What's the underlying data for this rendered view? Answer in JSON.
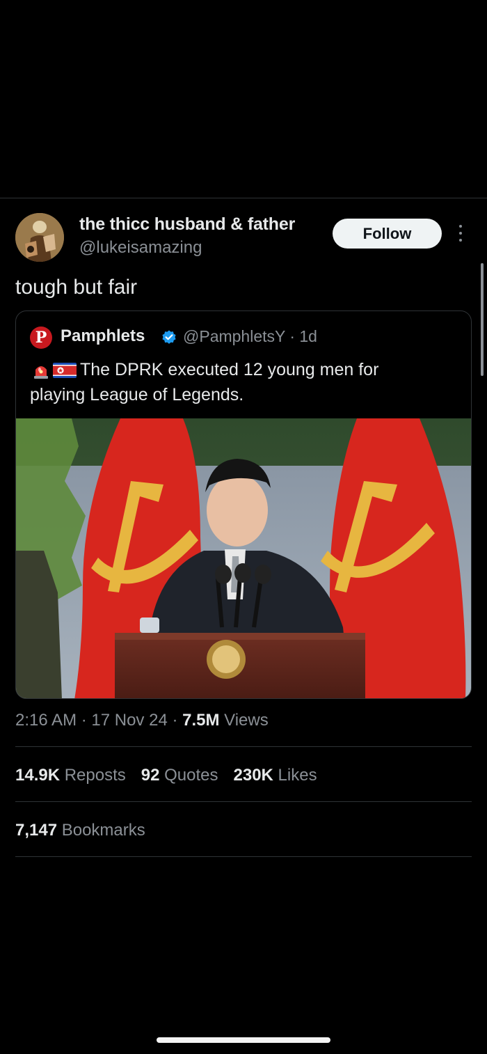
{
  "tweet": {
    "author_name": "the thicc husband & father",
    "author_handle": "@lukeisamazing",
    "follow_label": "Follow",
    "text": "tough but fair"
  },
  "quoted": {
    "logo_letter": "P",
    "name": "Pamphlets",
    "handle_time": "@PamphletsY · 1d",
    "text_line1": "The DPRK executed 12 young men for",
    "text_line2": "playing League of Legends."
  },
  "meta": {
    "time_date": "2:16 AM · 17 Nov 24 · ",
    "views_count": "7.5M",
    "views_label": " Views"
  },
  "stats": {
    "reposts_count": "14.9K",
    "reposts_label": " Reposts",
    "quotes_count": "92",
    "quotes_label": " Quotes",
    "likes_count": "230K",
    "likes_label": " Likes",
    "bookmarks_count": "7,147",
    "bookmarks_label": " Bookmarks"
  },
  "colors": {
    "background": "#000000",
    "follow_button": "#eff3f4",
    "verified": "#1d9bf0",
    "pamphlets_logo": "#c8191f"
  },
  "icons": {
    "more": "more-vertical-icon",
    "verified": "verified-badge-icon",
    "siren": "siren-emoji-icon",
    "flag": "north-korea-flag-icon"
  }
}
